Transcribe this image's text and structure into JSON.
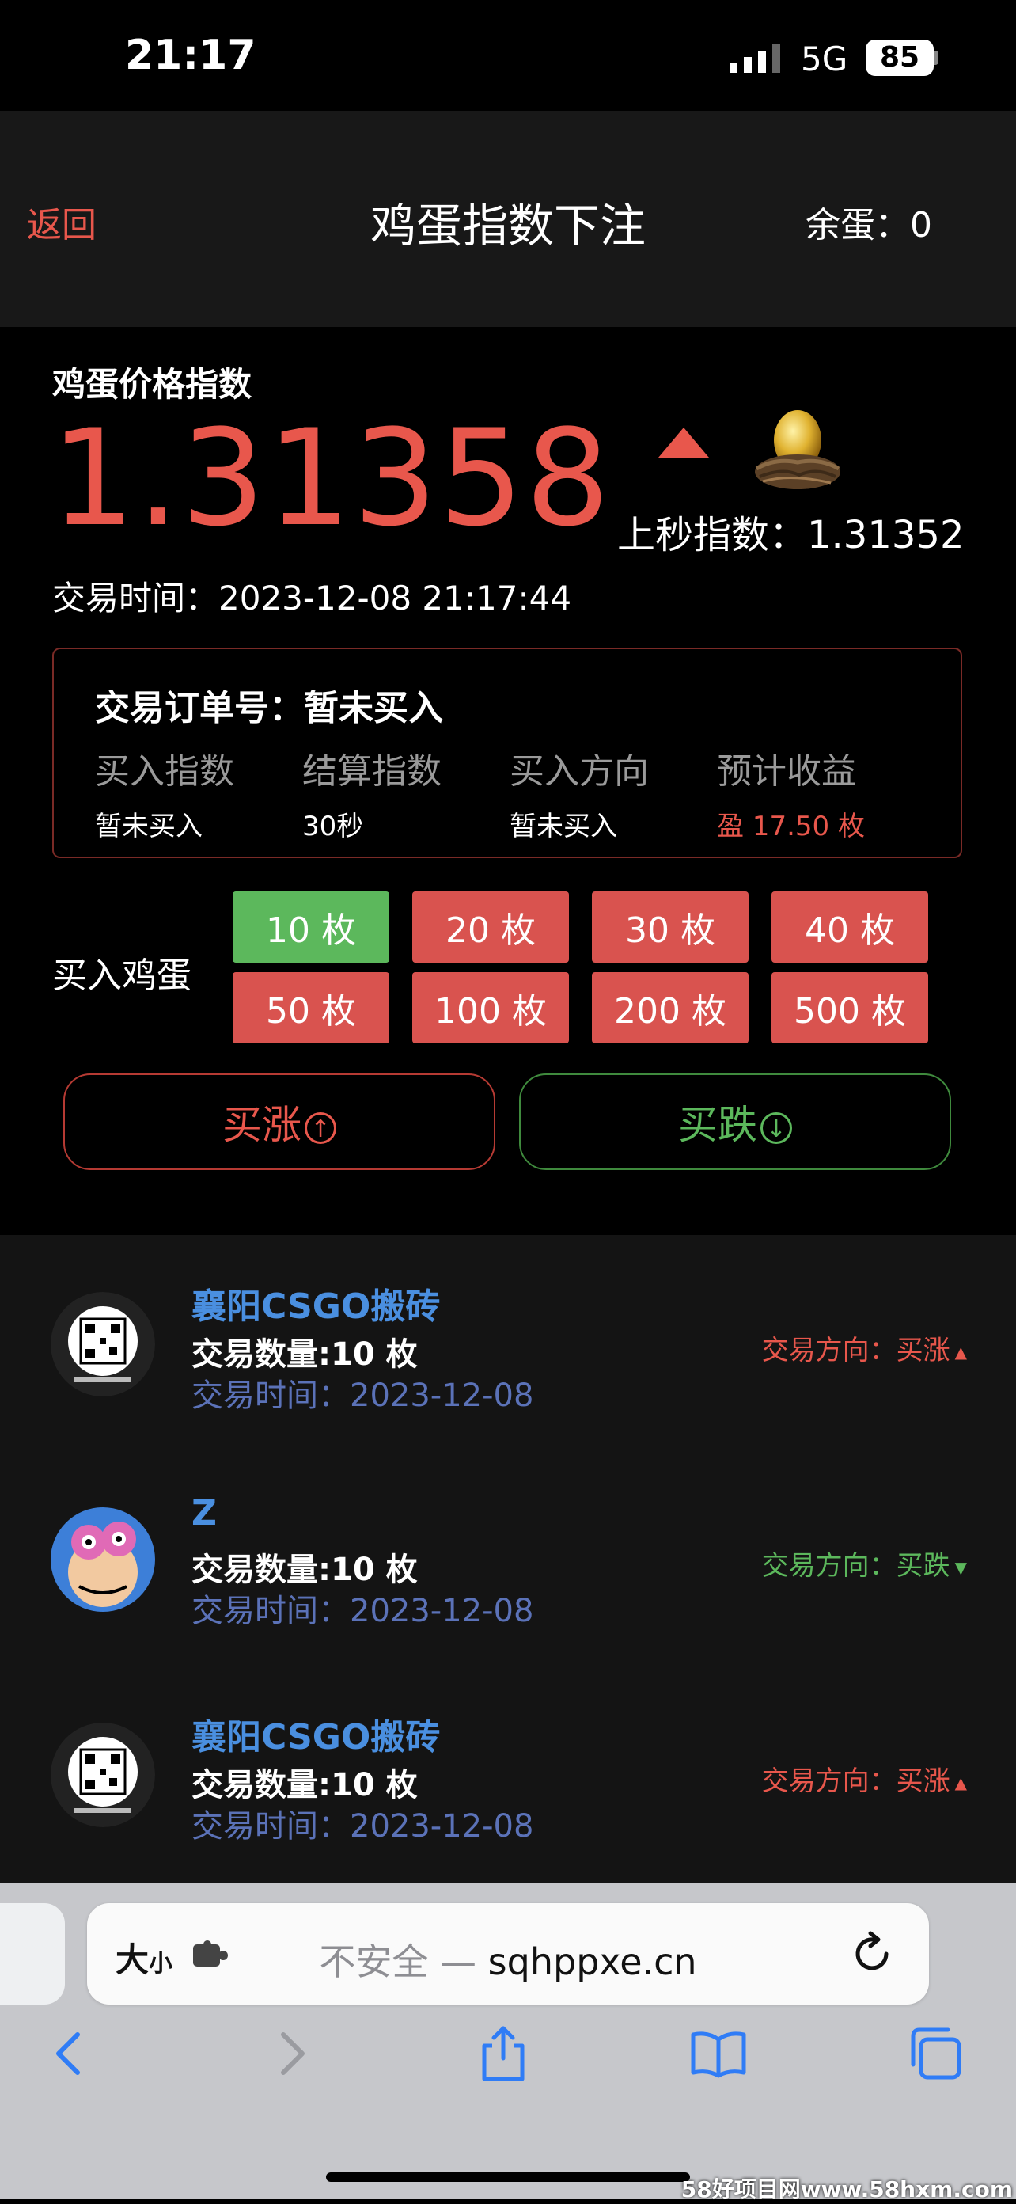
{
  "status_bar": {
    "time": "21:17",
    "network": "5G",
    "battery": "85"
  },
  "header": {
    "back": "返回",
    "title": "鸡蛋指数下注",
    "balance": "余蛋：0"
  },
  "index": {
    "label": "鸡蛋价格指数",
    "value": "1.31358",
    "prev_label": "上秒指数：1.31352",
    "trade_time": "交易时间：2023-12-08 21:17:44",
    "trend_color": "#e8574c"
  },
  "order": {
    "number_label": "交易订单号：暂未买入",
    "columns": [
      {
        "header": "买入指数",
        "value": "暂未买入"
      },
      {
        "header": "结算指数",
        "value": "30秒"
      },
      {
        "header": "买入方向",
        "value": "暂未买入"
      },
      {
        "header": "预计收益",
        "value": "盈 17.50 枚"
      }
    ]
  },
  "buy": {
    "label": "买入鸡蛋",
    "options": [
      "10 枚",
      "20 枚",
      "30 枚",
      "40 枚",
      "50 枚",
      "100 枚",
      "200 枚",
      "500 枚"
    ],
    "selected": "10 枚",
    "up_button": "买涨",
    "down_button": "买跌"
  },
  "trades": [
    {
      "user": "襄阳CSGO搬砖",
      "qty": "交易数量:10 枚",
      "time": "交易时间：2023-12-08",
      "direction": "交易方向：买涨"
    },
    {
      "user": "Z",
      "qty": "交易数量:10 枚",
      "time": "交易时间：2023-12-08",
      "direction": "交易方向：买跌"
    },
    {
      "user": "襄阳CSGO搬砖",
      "qty": "交易数量:10 枚",
      "time": "交易时间：2023-12-08",
      "direction": "交易方向：买涨"
    }
  ],
  "browser": {
    "text_size": "大",
    "text_size_small": "小",
    "url_insecure": "不安全 — ",
    "url_domain": "sqhppxe.cn"
  },
  "watermark": "58好项目网www.58hxm.com",
  "colors": {
    "up": "#e8574c",
    "down": "#5cb85c",
    "link": "#4a8fe0",
    "selected_qty": "#5cb85c",
    "qty": "#d9534f"
  }
}
